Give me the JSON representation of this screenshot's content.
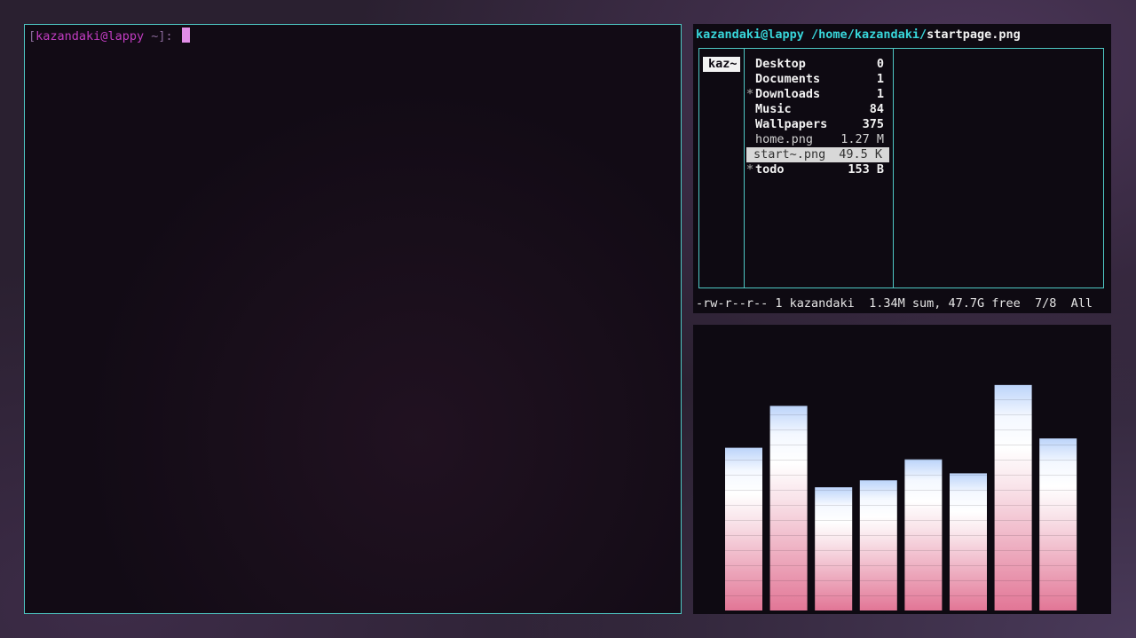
{
  "terminal": {
    "open_bracket": "[",
    "user": "kazandaki",
    "at": "@",
    "host": "lappy",
    "cwd": " ~",
    "close_bracket": "]",
    "prompt_end": ": "
  },
  "ranger": {
    "title_user_host": "kazandaki@lappy",
    "title_path": " /home/kazandaki/",
    "title_file": "startpage.png",
    "parent_label": "kaz~",
    "entries": [
      {
        "mark": "",
        "name": "Desktop",
        "size": "0"
      },
      {
        "mark": "",
        "name": "Documents",
        "size": "1"
      },
      {
        "mark": "*",
        "name": "Downloads",
        "size": "1"
      },
      {
        "mark": "",
        "name": "Music",
        "size": "84"
      },
      {
        "mark": "",
        "name": "Wallpapers",
        "size": "375"
      },
      {
        "mark": "",
        "name": "home.png",
        "size": "1.27 M"
      },
      {
        "mark": "",
        "name": "start~.png",
        "size": "49.5 K"
      },
      {
        "mark": "*",
        "name": "todo",
        "size": "153 B"
      }
    ],
    "status": "-rw-r--r-- 1 kazandaki  1.34M sum, 47.7G free  7/8  All"
  },
  "visualizer": {
    "bar_levels": [
      0.7,
      0.88,
      0.53,
      0.56,
      0.65,
      0.59,
      0.97,
      0.74
    ],
    "colors": {
      "bottom": "#e27696",
      "middle": "#f9e4ea",
      "top": "#ffffff",
      "peak": "#bcd4fa"
    }
  }
}
